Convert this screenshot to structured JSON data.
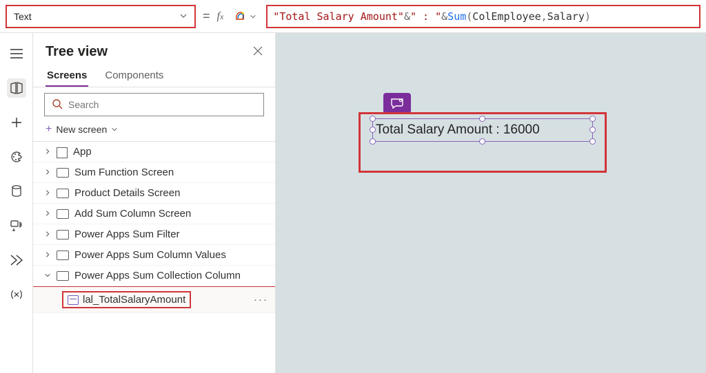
{
  "property_selector": {
    "value": "Text"
  },
  "formula_tokens": [
    {
      "t": "str",
      "v": "\"Total Salary Amount\""
    },
    {
      "t": "op",
      "v": " & "
    },
    {
      "t": "str",
      "v": "\" : \""
    },
    {
      "t": "op",
      "v": " & "
    },
    {
      "t": "fn",
      "v": "Sum"
    },
    {
      "t": "op",
      "v": "("
    },
    {
      "t": "id",
      "v": "ColEmployee"
    },
    {
      "t": "op",
      "v": ","
    },
    {
      "t": "id",
      "v": "Salary"
    },
    {
      "t": "op",
      "v": ")"
    }
  ],
  "tree": {
    "title": "Tree view",
    "tabs": {
      "screens": "Screens",
      "components": "Components"
    },
    "search_placeholder": "Search",
    "new_screen_label": "New screen",
    "items": [
      {
        "label": "App",
        "expanded": false,
        "icon": "app"
      },
      {
        "label": "Sum Function Screen",
        "expanded": false,
        "icon": "screen"
      },
      {
        "label": "Product Details Screen",
        "expanded": false,
        "icon": "screen"
      },
      {
        "label": "Add Sum Column Screen",
        "expanded": false,
        "icon": "screen"
      },
      {
        "label": "Power Apps Sum Filter",
        "expanded": false,
        "icon": "screen"
      },
      {
        "label": "Power Apps Sum Column Values",
        "expanded": false,
        "icon": "screen"
      },
      {
        "label": "Power Apps Sum Collection Column",
        "expanded": true,
        "icon": "screen"
      }
    ],
    "selected_child": {
      "label": "lal_TotalSalaryAmount"
    }
  },
  "canvas": {
    "label_text": "Total Salary Amount : 16000"
  }
}
